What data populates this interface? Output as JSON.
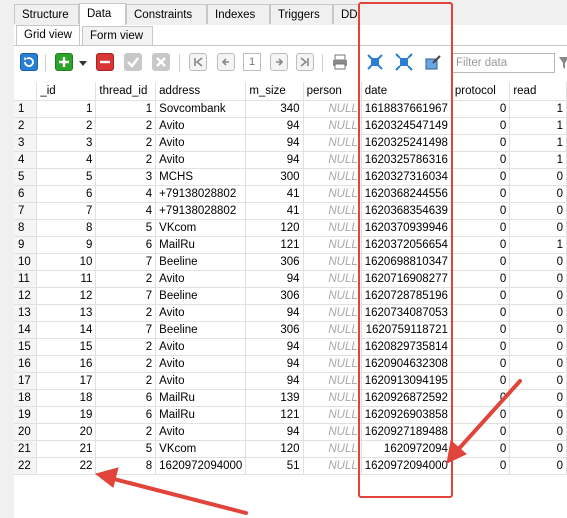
{
  "tabs": [
    "Structure",
    "Data",
    "Constraints",
    "Indexes",
    "Triggers",
    "DD"
  ],
  "active_tab": "Data",
  "subtabs": [
    "Grid view",
    "Form view"
  ],
  "active_subtab": "Grid view",
  "toolbar": {
    "page": "1",
    "filter_placeholder": "Filter data",
    "icons": [
      "refresh-icon",
      "add-row-icon",
      "dropdown-icon",
      "delete-row-icon",
      "commit-icon",
      "rollback-icon",
      "first-page-icon",
      "prev-page-icon",
      "next-page-icon",
      "last-page-icon",
      "print-icon",
      "export-icon",
      "import-icon",
      "edit-icon",
      "filter-icon"
    ]
  },
  "grid": {
    "columns": [
      "_id",
      "thread_id",
      "address",
      "m_size",
      "person",
      "date",
      "protocol",
      "read"
    ],
    "rows": [
      [
        "1",
        "1",
        "1",
        "Sovcombank",
        "340",
        "NULL",
        "1618837661967",
        "0",
        "1"
      ],
      [
        "2",
        "2",
        "2",
        "Avito",
        "94",
        "NULL",
        "1620324547149",
        "0",
        "1"
      ],
      [
        "3",
        "3",
        "2",
        "Avito",
        "94",
        "NULL",
        "1620325241498",
        "0",
        "1"
      ],
      [
        "4",
        "4",
        "2",
        "Avito",
        "94",
        "NULL",
        "1620325786316",
        "0",
        "1"
      ],
      [
        "5",
        "5",
        "3",
        "MCHS",
        "300",
        "NULL",
        "1620327316034",
        "0",
        "0"
      ],
      [
        "6",
        "6",
        "4",
        "+79138028802",
        "41",
        "NULL",
        "1620368244556",
        "0",
        "0"
      ],
      [
        "7",
        "7",
        "4",
        "+79138028802",
        "41",
        "NULL",
        "1620368354639",
        "0",
        "0"
      ],
      [
        "8",
        "8",
        "5",
        "VKcom",
        "120",
        "NULL",
        "1620370939946",
        "0",
        "0"
      ],
      [
        "9",
        "9",
        "6",
        "MailRu",
        "121",
        "NULL",
        "1620372056654",
        "0",
        "1"
      ],
      [
        "10",
        "10",
        "7",
        "Beeline",
        "306",
        "NULL",
        "1620698810347",
        "0",
        "0"
      ],
      [
        "11",
        "11",
        "2",
        "Avito",
        "94",
        "NULL",
        "1620716908277",
        "0",
        "0"
      ],
      [
        "12",
        "12",
        "7",
        "Beeline",
        "306",
        "NULL",
        "1620728785196",
        "0",
        "0"
      ],
      [
        "13",
        "13",
        "2",
        "Avito",
        "94",
        "NULL",
        "1620734087053",
        "0",
        "0"
      ],
      [
        "14",
        "14",
        "7",
        "Beeline",
        "306",
        "NULL",
        "1620759118721",
        "0",
        "0"
      ],
      [
        "15",
        "15",
        "2",
        "Avito",
        "94",
        "NULL",
        "1620829735814",
        "0",
        "0"
      ],
      [
        "16",
        "16",
        "2",
        "Avito",
        "94",
        "NULL",
        "1620904632308",
        "0",
        "0"
      ],
      [
        "17",
        "17",
        "2",
        "Avito",
        "94",
        "NULL",
        "1620913094195",
        "0",
        "0"
      ],
      [
        "18",
        "18",
        "6",
        "MailRu",
        "139",
        "NULL",
        "1620926872592",
        "0",
        "0"
      ],
      [
        "19",
        "19",
        "6",
        "MailRu",
        "121",
        "NULL",
        "1620926903858",
        "0",
        "0"
      ],
      [
        "20",
        "20",
        "2",
        "Avito",
        "94",
        "NULL",
        "1620927189488",
        "0",
        "0"
      ],
      [
        "21",
        "21",
        "5",
        "VKcom",
        "120",
        "NULL",
        "1620972094",
        "0",
        "0"
      ],
      [
        "22",
        "22",
        "8",
        "1620972094000",
        "51",
        "NULL",
        "1620972094000",
        "0",
        "0"
      ]
    ]
  },
  "colors": {
    "annotation": "#e0443a",
    "null_text": "#a8a8a8",
    "accent_blue": "#2a7fd4",
    "add_green": "#2aa52a",
    "delete_red": "#d83535"
  }
}
